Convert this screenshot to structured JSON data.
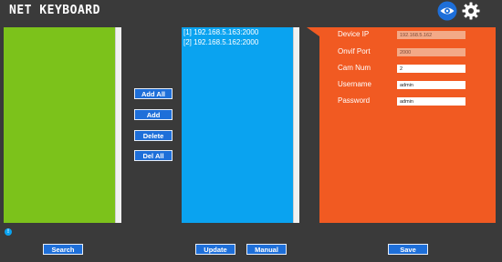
{
  "header": {
    "title": "NET KEYBOARD"
  },
  "icons": {
    "eye": "eye-icon",
    "gear": "gear-icon",
    "help": "info-icon"
  },
  "left_panel": {
    "items": []
  },
  "side_buttons": {
    "add_all": "Add All",
    "add": "Add",
    "delete": "Delete",
    "del_all": "Del All"
  },
  "middle_panel": {
    "items": [
      "[1] 192.168.5.163:2000",
      "[2] 192.168.5.162:2000"
    ]
  },
  "form": {
    "device_ip_label": "Device IP",
    "device_ip_value": "192.168.5.162",
    "onvif_port_label": "Onvif Port",
    "onvif_port_value": "2000",
    "cam_num_label": "Cam Num",
    "cam_num_value": "2",
    "username_label": "Username",
    "username_value": "admin",
    "password_label": "Password",
    "password_value": "admin"
  },
  "bottom": {
    "help_glyph": "!",
    "search": "Search",
    "update": "Update",
    "manual": "Manual",
    "save": "Save"
  },
  "colors": {
    "background": "#3a3a3a",
    "left_panel": "#7cc21b",
    "middle_panel": "#0aa3f0",
    "right_panel": "#f15a22",
    "button": "#1e6fd9"
  }
}
